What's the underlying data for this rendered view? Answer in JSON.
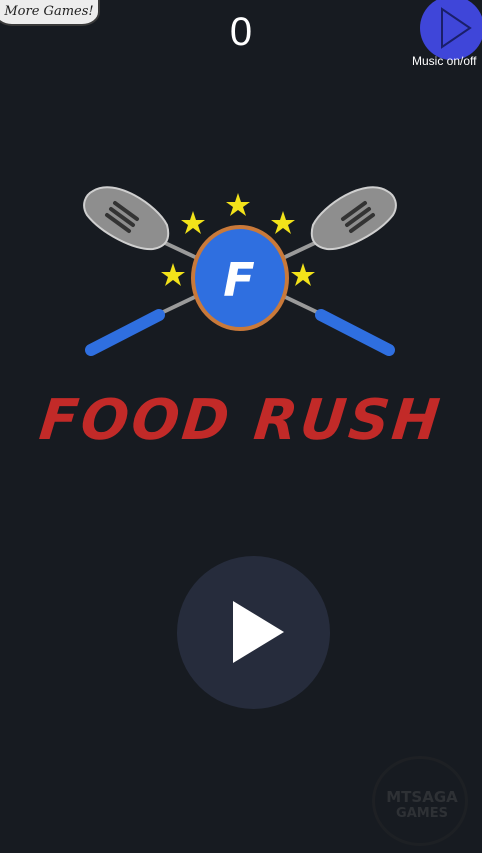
{
  "header": {
    "more_games_label": "More Games!",
    "score": "0",
    "music_label": "Music on/off"
  },
  "logo": {
    "emblem_letter": "F",
    "title": "FOOD RUSH"
  },
  "play": {
    "icon": "play-icon"
  },
  "watermark": {
    "line1": "MTSAGA",
    "line2": "GAMES"
  },
  "colors": {
    "background": "#171b21",
    "title": "#c22a28",
    "emblem": "#2f6fe0",
    "handle": "#2f6fe0",
    "music_button": "#3f46d9",
    "play_button": "#262c3c",
    "star": "#f2e21a"
  }
}
